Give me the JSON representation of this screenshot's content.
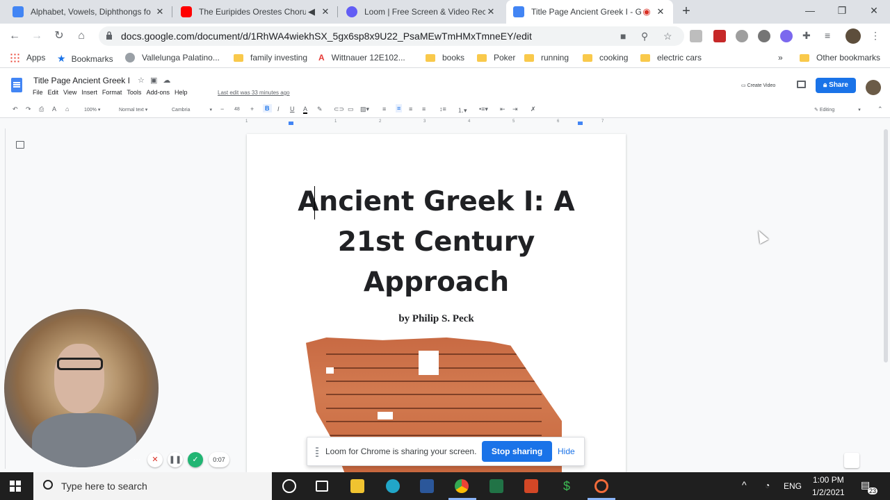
{
  "tabs": [
    {
      "title": "Alphabet, Vowels, Diphthongs fo",
      "icon": "google-docs-icon",
      "color": "#4285f4"
    },
    {
      "title": "The Euripides Orestes Choru",
      "icon": "youtube-icon",
      "color": "#ff0000"
    },
    {
      "title": "Loom | Free Screen & Video Reco",
      "icon": "loom-icon",
      "color": "#625df5"
    },
    {
      "title": "Title Page Ancient Greek I - G",
      "icon": "google-docs-icon",
      "color": "#4285f4"
    }
  ],
  "address": {
    "url": "docs.google.com/document/d/1RhWA4wiekhSX_5gx6sp8x9U22_PsaMEwTmHMxTmneEY/edit"
  },
  "bookmarks": {
    "apps": "Apps",
    "items": [
      "Bookmarks",
      "Vallelunga Palatino...",
      "family investing",
      "Wittnauer 12E102...",
      "books",
      "Poker",
      "running",
      "cooking",
      "electric cars"
    ],
    "more": "»",
    "other": "Other bookmarks"
  },
  "docs": {
    "title": "Title Page Ancient Greek I",
    "menu": [
      "File",
      "Edit",
      "View",
      "Insert",
      "Format",
      "Tools",
      "Add-ons",
      "Help"
    ],
    "last_edit": "Last edit was 33 minutes ago",
    "create_video": "Create Video",
    "share": "Share"
  },
  "format_bar": {
    "zoom": "100%",
    "style": "Normal text",
    "font": "Cambria",
    "font_size": "48",
    "mode": "Editing"
  },
  "ruler_labels": [
    "1",
    "1",
    "2",
    "3",
    "4",
    "5",
    "6",
    "7"
  ],
  "document": {
    "heading_lines": [
      "Ancient Greek I: A",
      "21st Century",
      "Approach"
    ],
    "byline": "by Philip S. Peck"
  },
  "loom": {
    "timer": "0:07",
    "share_message": "Loom for Chrome is sharing your screen.",
    "stop_sharing": "Stop sharing",
    "hide": "Hide"
  },
  "taskbar": {
    "search_placeholder": "Type here to search",
    "language": "ENG",
    "time": "1:00 PM",
    "date": "1/2/2021",
    "notifications": "23"
  },
  "colors": {
    "accent": "#1a73e8",
    "docs_blue": "#4285f4"
  }
}
